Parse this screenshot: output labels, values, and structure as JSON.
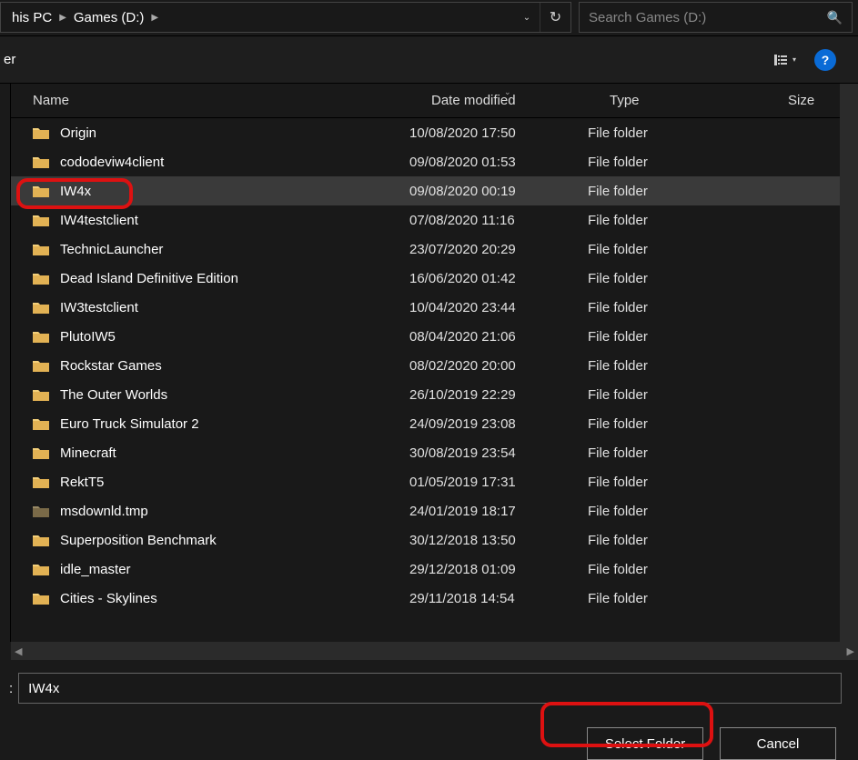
{
  "breadcrumb": {
    "crumb1": "his PC",
    "crumb2": "Games (D:)"
  },
  "search": {
    "placeholder": "Search Games (D:)"
  },
  "toolbar_left": "er",
  "columns": {
    "name": "Name",
    "date": "Date modified",
    "type": "Type",
    "size": "Size"
  },
  "rows": [
    {
      "name": "Origin",
      "date": "10/08/2020 17:50",
      "type": "File folder",
      "selected": false,
      "icon": "folder"
    },
    {
      "name": "cododeviw4client",
      "date": "09/08/2020 01:53",
      "type": "File folder",
      "selected": false,
      "icon": "folder"
    },
    {
      "name": "IW4x",
      "date": "09/08/2020 00:19",
      "type": "File folder",
      "selected": true,
      "icon": "folder"
    },
    {
      "name": "IW4testclient",
      "date": "07/08/2020 11:16",
      "type": "File folder",
      "selected": false,
      "icon": "folder"
    },
    {
      "name": "TechnicLauncher",
      "date": "23/07/2020 20:29",
      "type": "File folder",
      "selected": false,
      "icon": "folder"
    },
    {
      "name": "Dead Island Definitive Edition",
      "date": "16/06/2020 01:42",
      "type": "File folder",
      "selected": false,
      "icon": "folder"
    },
    {
      "name": "IW3testclient",
      "date": "10/04/2020 23:44",
      "type": "File folder",
      "selected": false,
      "icon": "folder"
    },
    {
      "name": "PlutoIW5",
      "date": "08/04/2020 21:06",
      "type": "File folder",
      "selected": false,
      "icon": "folder"
    },
    {
      "name": "Rockstar Games",
      "date": "08/02/2020 20:00",
      "type": "File folder",
      "selected": false,
      "icon": "folder"
    },
    {
      "name": "The Outer Worlds",
      "date": "26/10/2019 22:29",
      "type": "File folder",
      "selected": false,
      "icon": "folder"
    },
    {
      "name": "Euro Truck Simulator 2",
      "date": "24/09/2019 23:08",
      "type": "File folder",
      "selected": false,
      "icon": "folder"
    },
    {
      "name": "Minecraft",
      "date": "30/08/2019 23:54",
      "type": "File folder",
      "selected": false,
      "icon": "folder"
    },
    {
      "name": "RektT5",
      "date": "01/05/2019 17:31",
      "type": "File folder",
      "selected": false,
      "icon": "folder"
    },
    {
      "name": "msdownld.tmp",
      "date": "24/01/2019 18:17",
      "type": "File folder",
      "selected": false,
      "icon": "folder-dim"
    },
    {
      "name": "Superposition Benchmark",
      "date": "30/12/2018 13:50",
      "type": "File folder",
      "selected": false,
      "icon": "folder"
    },
    {
      "name": "idle_master",
      "date": "29/12/2018 01:09",
      "type": "File folder",
      "selected": false,
      "icon": "folder"
    },
    {
      "name": "Cities - Skylines",
      "date": "29/11/2018 14:54",
      "type": "File folder",
      "selected": false,
      "icon": "folder"
    }
  ],
  "folder_field": {
    "value": "IW4x"
  },
  "buttons": {
    "select": "Select Folder",
    "cancel": "Cancel"
  }
}
